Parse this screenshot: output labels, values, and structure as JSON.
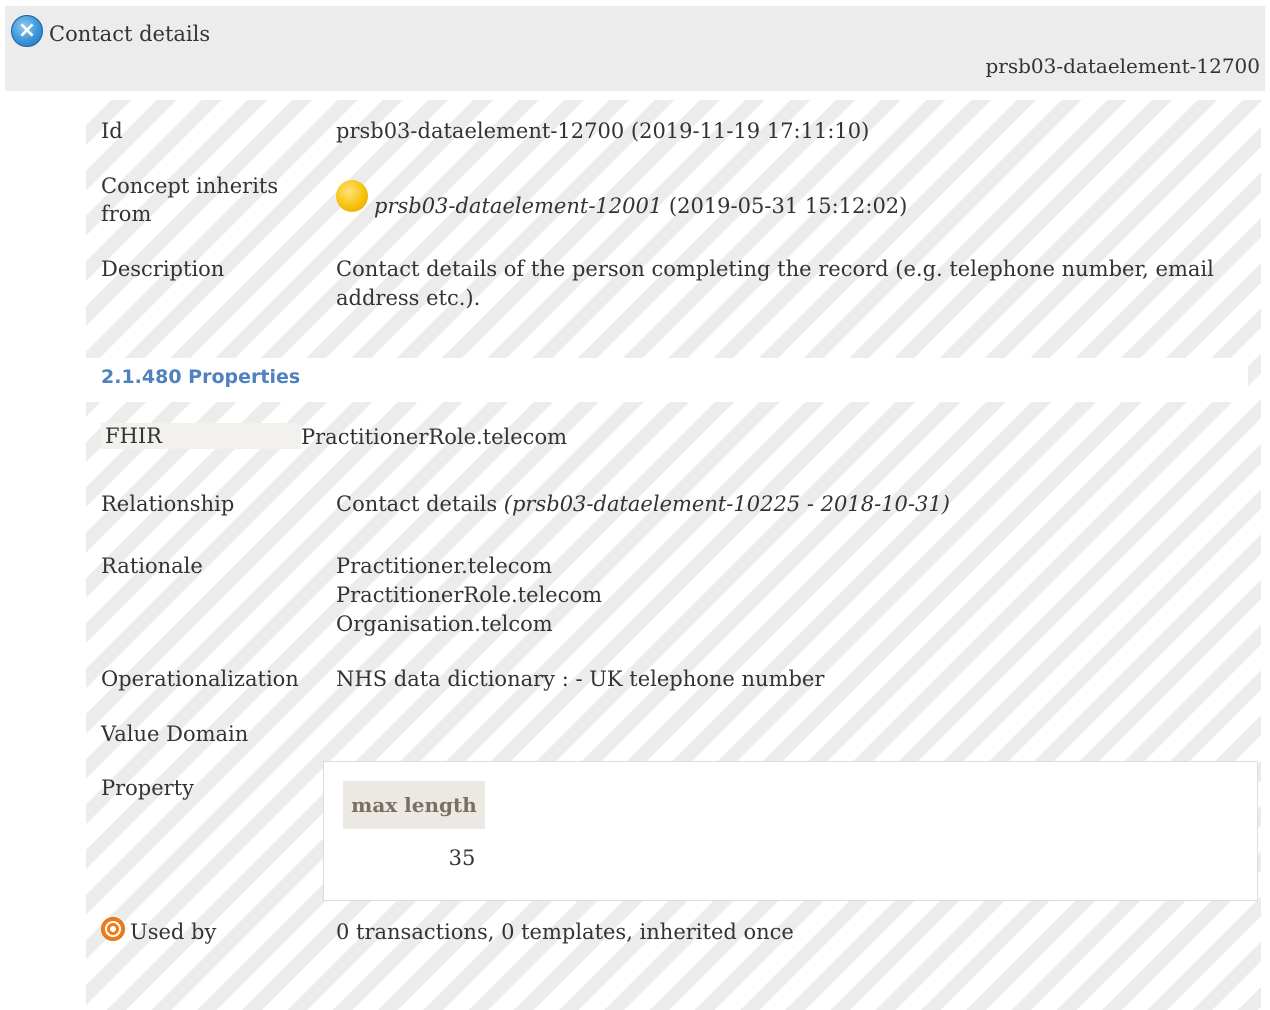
{
  "header": {
    "title": "Contact details",
    "id": "prsb03-dataelement-12700",
    "close_icon": "close-circle-icon"
  },
  "rows": {
    "id": {
      "label": "Id",
      "value": "prsb03-dataelement-12700 (2019-11-19 17:11:10)"
    },
    "inherits": {
      "label_line1": "Concept inherits",
      "label_line2": "from",
      "icon": "sun-icon",
      "ref": "prsb03-dataelement-12001",
      "date": "(2019-05-31 15:12:02)"
    },
    "description": {
      "label": "Description",
      "line1": "Contact details of the person completing the record (e.g. telephone number, email",
      "line2": "address etc.)."
    }
  },
  "properties_section": {
    "heading": "2.1.480 Properties",
    "fhir": {
      "label": "FHIR",
      "value": "PractitionerRole.telecom"
    },
    "relationship": {
      "label": "Relationship",
      "value": "Contact details",
      "ref": "(prsb03-dataelement-10225 - 2018-10-31)"
    },
    "rationale": {
      "label": "Rationale",
      "lines": [
        "Practitioner.telecom",
        "PractitionerRole.telecom",
        "Organisation.telcom"
      ]
    },
    "operationalization": {
      "label": "Operationalization",
      "value": "NHS data dictionary : - UK telephone number"
    },
    "value_domain": {
      "label": "Value Domain"
    },
    "property": {
      "label": "Property",
      "header": "max length",
      "value": "35"
    },
    "used_by": {
      "label": "Used by",
      "icon": "target-icon",
      "value": "0 transactions, 0 templates, inherited once"
    }
  },
  "colors": {
    "heading": "#4f81bd",
    "header_bg": "#ececec",
    "stripe": "#ececec"
  }
}
